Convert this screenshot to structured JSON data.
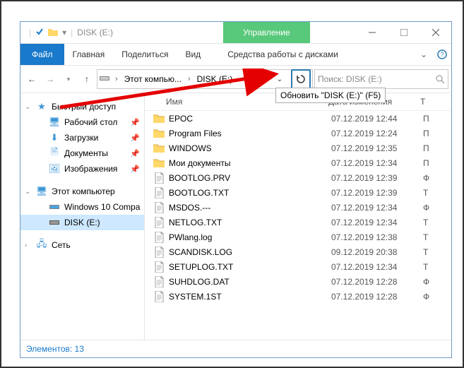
{
  "titlebar": {
    "title": "DISK (E:)",
    "manage": "Управление"
  },
  "ribbon": {
    "file": "Файл",
    "home": "Главная",
    "share": "Поделиться",
    "view": "Вид",
    "context": "Средства работы с дисками"
  },
  "nav": {
    "breadcrumb_root": "Этот компью...",
    "breadcrumb_current": "DISK (E:)"
  },
  "search": {
    "placeholder": "Поиск: DISK (E:)"
  },
  "tooltip": "Обновить \"DISK (E:)\" (F5)",
  "navpane": {
    "quick": "Быстрый доступ",
    "desktop": "Рабочий стол",
    "downloads": "Загрузки",
    "documents": "Документы",
    "pictures": "Изображения",
    "thispc": "Этот компьютер",
    "win10": "Windows 10 Compa",
    "diske": "DISK (E:)",
    "network": "Сеть"
  },
  "list": {
    "col_name": "Имя",
    "col_date": "Дата изменения",
    "col_type": "Т",
    "rows": [
      {
        "icon": "folder",
        "name": "EPOC",
        "date": "07.12.2019 12:44",
        "type": "П"
      },
      {
        "icon": "folder",
        "name": "Program Files",
        "date": "07.12.2019 12:24",
        "type": "П"
      },
      {
        "icon": "folder",
        "name": "WINDOWS",
        "date": "07.12.2019 12:35",
        "type": "П"
      },
      {
        "icon": "folder",
        "name": "Мои документы",
        "date": "07.12.2019 12:34",
        "type": "П"
      },
      {
        "icon": "file",
        "name": "BOOTLOG.PRV",
        "date": "07.12.2019 12:39",
        "type": "Ф"
      },
      {
        "icon": "file",
        "name": "BOOTLOG.TXT",
        "date": "07.12.2019 12:39",
        "type": "Т"
      },
      {
        "icon": "file",
        "name": "MSDOS.---",
        "date": "07.12.2019 12:34",
        "type": "Ф"
      },
      {
        "icon": "file",
        "name": "NETLOG.TXT",
        "date": "07.12.2019 12:34",
        "type": "Т"
      },
      {
        "icon": "file",
        "name": "PWlang.log",
        "date": "07.12.2019 12:38",
        "type": "Т"
      },
      {
        "icon": "file",
        "name": "SCANDISK.LOG",
        "date": "09.12.2019 20:38",
        "type": "Т"
      },
      {
        "icon": "file",
        "name": "SETUPLOG.TXT",
        "date": "07.12.2019 12:34",
        "type": "Т"
      },
      {
        "icon": "file",
        "name": "SUHDLOG.DAT",
        "date": "07.12.2019 12:28",
        "type": "Ф"
      },
      {
        "icon": "file",
        "name": "SYSTEM.1ST",
        "date": "07.12.2019 12:28",
        "type": "Ф"
      }
    ]
  },
  "status": {
    "count": "Элементов: 13"
  }
}
